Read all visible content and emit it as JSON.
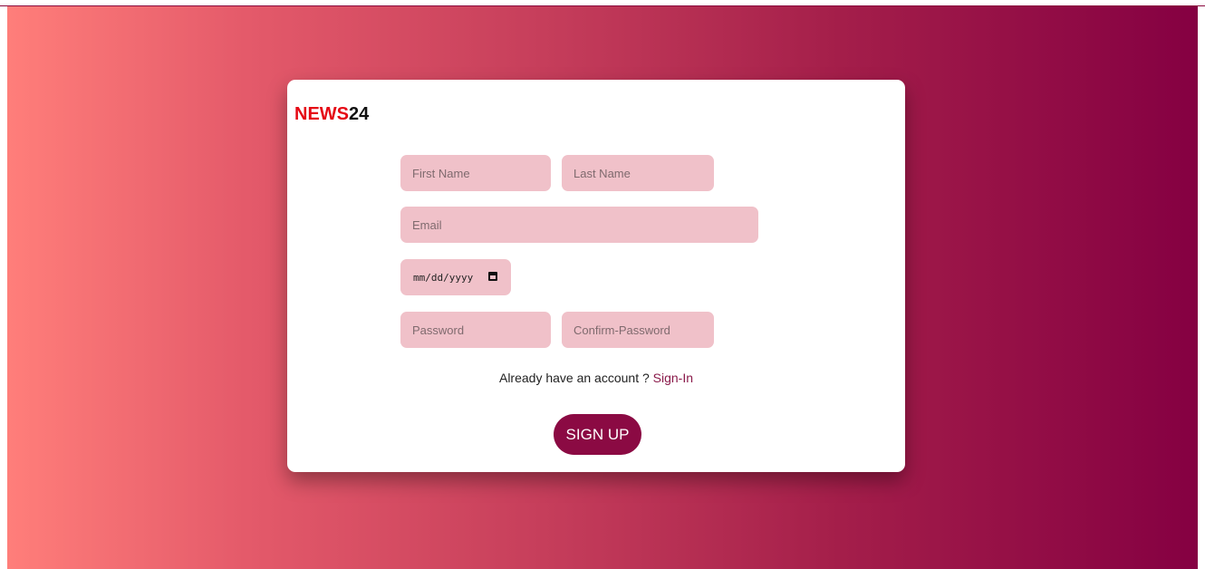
{
  "brand": {
    "logo_red": "NEWS",
    "logo_black": "24"
  },
  "colors": {
    "gradient_start": "#ff7e7a",
    "gradient_end": "#850042",
    "field_bg": "#f0c1c9",
    "button_bg": "#8b0a43",
    "logo_red": "#e50914",
    "link": "#8a1a4a"
  },
  "form": {
    "first_name": {
      "placeholder": "First Name",
      "value": ""
    },
    "last_name": {
      "placeholder": "Last Name",
      "value": ""
    },
    "email": {
      "placeholder": "Email",
      "value": ""
    },
    "dob": {
      "display": "mm/dd/yyyy",
      "icon": "calendar-icon"
    },
    "password": {
      "placeholder": "Password",
      "value": ""
    },
    "confirm_password": {
      "placeholder": "Confirm-Password",
      "value": ""
    }
  },
  "signin": {
    "prompt": "Already have an account ? ",
    "link_label": "Sign-In"
  },
  "signup_button": {
    "label": "SIGN UP"
  }
}
